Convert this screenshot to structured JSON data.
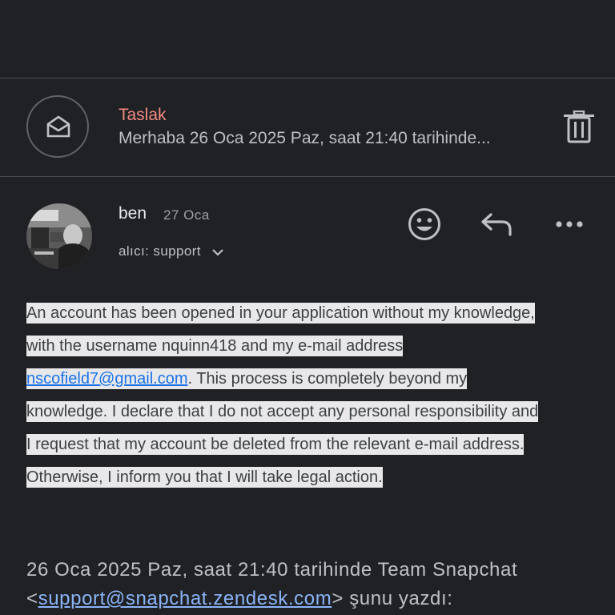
{
  "draft": {
    "label": "Taslak",
    "snippet": "Merhaba 26 Oca 2025 Paz, saat 21:40 tarihinde..."
  },
  "message": {
    "sender": "ben",
    "date": "27 Oca",
    "recipient": "alıcı: support",
    "body": {
      "line1": "An account has been opened in your application without my knowledge,",
      "line2": "with the username nquinn418 and my e-mail address",
      "email_link": "nscofield7@gmail.com",
      "line3_rest": ". This process is completely beyond my",
      "line4": "knowledge. I declare that I do not accept any personal responsibility and",
      "line5": "I request that my account be deleted from the relevant e-mail address.",
      "line6": "Otherwise, I inform you that I will take legal action."
    },
    "quote": {
      "intro": "26 Oca 2025 Paz, saat 21:40 tarihinde Team Snapchat",
      "open_bracket": "<",
      "link": "support@snapchat.zendesk.com",
      "close": "> şunu yazdı:"
    }
  },
  "icons": {
    "draft": "mail-open-icon",
    "trash": "trash-icon",
    "emoji": "emoji-reaction-icon",
    "reply": "reply-icon",
    "more": "more-horizontal-icon",
    "chevron": "chevron-down-icon"
  },
  "colors": {
    "background": "#202124",
    "draft_label": "#f28b82",
    "link": "#1a73e8",
    "quote_link": "#8ab4f8",
    "highlight": "#e8e8ea"
  }
}
